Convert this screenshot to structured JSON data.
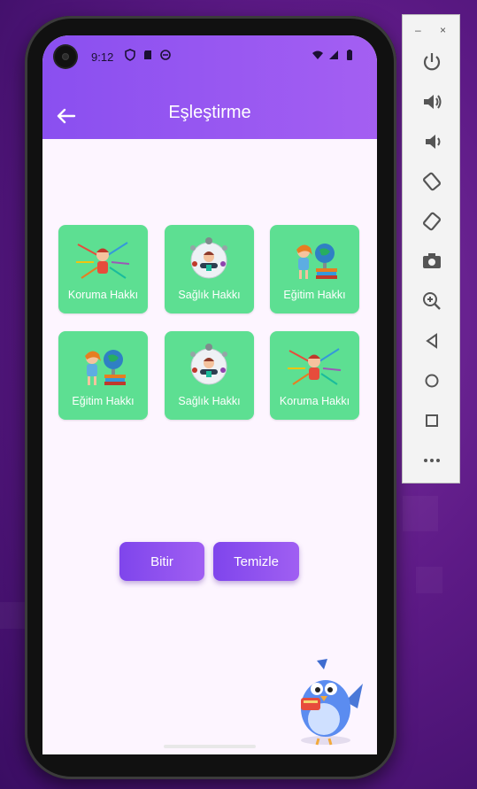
{
  "status_bar": {
    "time": "9:12"
  },
  "app_bar": {
    "title": "Eşleştirme"
  },
  "cards": [
    {
      "label": "Koruma Hakkı",
      "art": "protection-art"
    },
    {
      "label": "Sağlık Hakkı",
      "art": "health-art"
    },
    {
      "label": "Eğitim Hakkı",
      "art": "education-art"
    },
    {
      "label": "Eğitim Hakkı",
      "art": "education-art"
    },
    {
      "label": "Sağlık Hakkı",
      "art": "health-art"
    },
    {
      "label": "Koruma Hakkı",
      "art": "protection-art"
    }
  ],
  "buttons": {
    "finish": "Bitir",
    "clear": "Temizle"
  },
  "colors": {
    "app_bar": "#8a4ff0",
    "card": "#5ddf92",
    "button": "#8a4ff0",
    "screen_bg": "#fdf5ff"
  },
  "emulator_toolbar": {
    "minimize": "–",
    "close": "×",
    "tools": [
      "power-icon",
      "volume-up-icon",
      "volume-down-icon",
      "rotate-left-icon",
      "rotate-right-icon",
      "camera-icon",
      "zoom-icon",
      "back-icon",
      "home-icon",
      "overview-icon",
      "more-icon"
    ]
  }
}
